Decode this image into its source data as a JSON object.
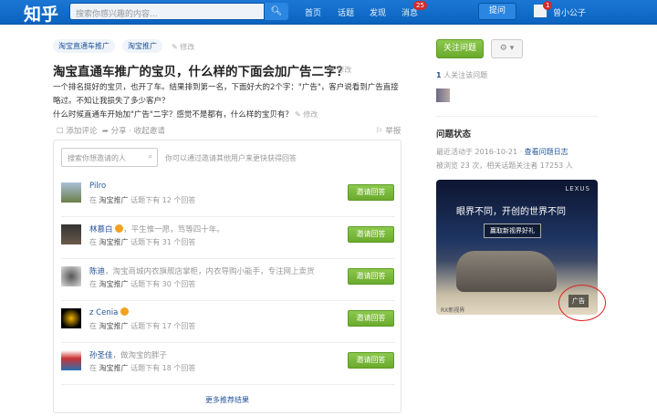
{
  "header": {
    "logo": "知乎",
    "search_placeholder": "搜索你感兴趣的内容...",
    "nav": [
      "首页",
      "话题",
      "发现",
      "消息"
    ],
    "messages_badge": "25",
    "ask": "提问",
    "user_badge": "1",
    "username": "曾小公子"
  },
  "question": {
    "tags": [
      "淘宝直通车推广",
      "淘宝推广"
    ],
    "edit": "修改",
    "title": "淘宝直通车推广的宝贝，什么样的下面会加广告二字？",
    "desc1": "一个排名挺好的宝贝，也开了车。结果排到第一名，下面好大的2个字：\"广告\"，客户说看到广告直接",
    "desc2": "略过。不知让我损失了多少客户？",
    "desc3": "什么时候直通车开始加\"广告\"二字？感觉不是都有，什么样的宝贝有？",
    "add_comment": "添加评论",
    "share": "分享",
    "collapse_invite": "收起邀请",
    "report": "举报"
  },
  "invite": {
    "search_placeholder": "搜索你想邀请的人",
    "hint": "你可以通过邀请其他用户来更快获得回答",
    "button": "邀请回答",
    "more": "更多推荐结果",
    "people": [
      {
        "name": "Pilro",
        "bio": "",
        "verified": false,
        "pre": "在",
        "topic": "淘宝推广",
        "post": "话题下有 12 个回答"
      },
      {
        "name": "林慕白",
        "bio": "，平生惟一愿，笃等四十年。",
        "verified": true,
        "pre": "在",
        "topic": "淘宝推广",
        "post": "话题下有 31 个回答"
      },
      {
        "name": "陈迪",
        "bio": "，淘宝商城内衣旗舰店掌柜，内衣导购小能手，专注网上卖货",
        "verified": false,
        "pre": "在",
        "topic": "淘宝推广",
        "post": "话题下有 30 个回答"
      },
      {
        "name": "z Cenia",
        "bio": "",
        "verified": true,
        "pre": "在",
        "topic": "淘宝推广",
        "post": "话题下有 17 个回答"
      },
      {
        "name": "孙圣佳",
        "bio": "，做淘宝的胖子",
        "verified": false,
        "pre": "在",
        "topic": "淘宝推广",
        "post": "话题下有 18 个回答"
      }
    ]
  },
  "sidebar": {
    "follow": "关注问题",
    "followers_count": "1",
    "followers_text": "人关注该问题",
    "status_title": "问题状态",
    "last_active": "最近活动于 2016-10-21 ·",
    "view_log": "查看问题日志",
    "stats": "被浏览 23 次，相关话题关注者 17253 人"
  },
  "ad": {
    "brand": "LEXUS",
    "headline": "眼界不同，开创的世界不同",
    "cta": "赢取新视界好礼",
    "model": "RX新视界",
    "label": "广告"
  }
}
